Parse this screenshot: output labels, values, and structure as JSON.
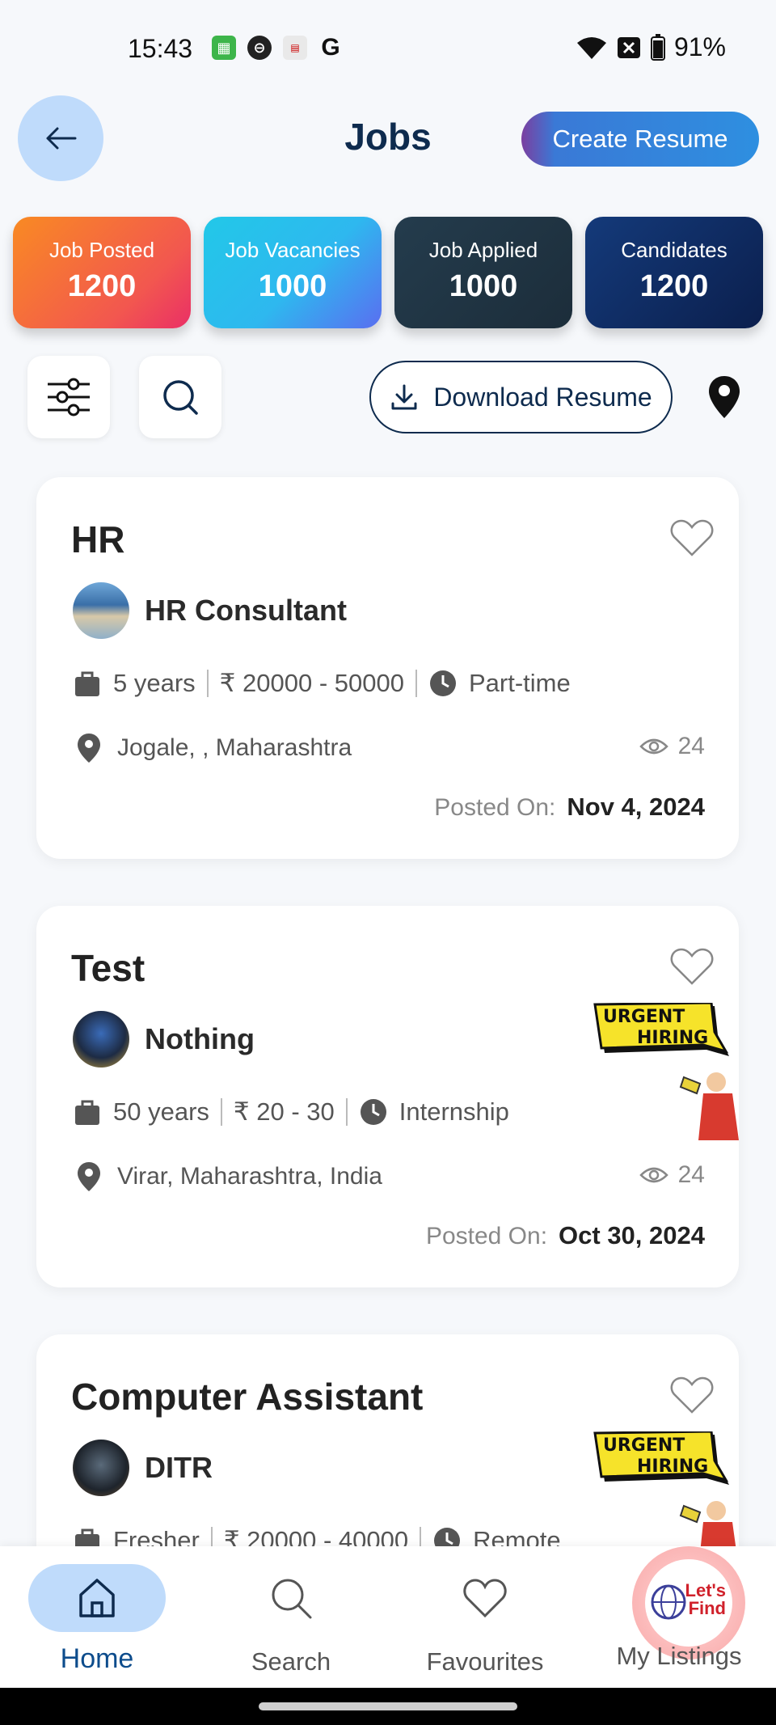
{
  "status_bar": {
    "time": "15:43",
    "battery": "91%",
    "icons": [
      "calendar-app-icon",
      "metro-app-icon",
      "news-app-icon",
      "google-icon",
      "wifi-icon",
      "no-sim-icon",
      "battery-icon"
    ]
  },
  "header": {
    "title": "Jobs",
    "create_resume": "Create Resume"
  },
  "stats": [
    {
      "label": "Job Posted",
      "value": "1200"
    },
    {
      "label": "Job Vacancies",
      "value": "1000"
    },
    {
      "label": "Job Applied",
      "value": "1000"
    },
    {
      "label": "Candidates",
      "value": "1200"
    }
  ],
  "toolbar": {
    "download_resume": "Download Resume"
  },
  "jobs": [
    {
      "title": "HR",
      "company": "HR Consultant",
      "experience": "5 years",
      "salary": "₹ 20000 - 50000",
      "type": "Part-time",
      "location": "Jogale, , Maharashtra",
      "views": "24",
      "posted_label": "Posted On:",
      "posted_date": "Nov 4, 2024",
      "urgent": false
    },
    {
      "title": "Test",
      "company": "Nothing",
      "experience": "50 years",
      "salary": "₹ 20 - 30",
      "type": "Internship",
      "location": "Virar, Maharashtra, India",
      "views": "24",
      "posted_label": "Posted On:",
      "posted_date": "Oct 30, 2024",
      "urgent": true,
      "badge_line1": "URGENT",
      "badge_line2": "HIRING"
    },
    {
      "title": "Computer Assistant",
      "company": "DITR",
      "experience": "Fresher",
      "salary": "₹ 20000 - 40000",
      "type": "Remote",
      "urgent": true,
      "badge_line1": "URGENT",
      "badge_line2": "HIRING"
    }
  ],
  "bottom_nav": {
    "home": "Home",
    "search": "Search",
    "favourites": "Favourites",
    "my_listings": "My Listings",
    "logo_line1": "Let's",
    "logo_line2": "Find"
  },
  "colors": {
    "primary": "#0e2b4e",
    "accent_blue": "#bfdbfb",
    "active_nav": "#0d4c8c"
  }
}
